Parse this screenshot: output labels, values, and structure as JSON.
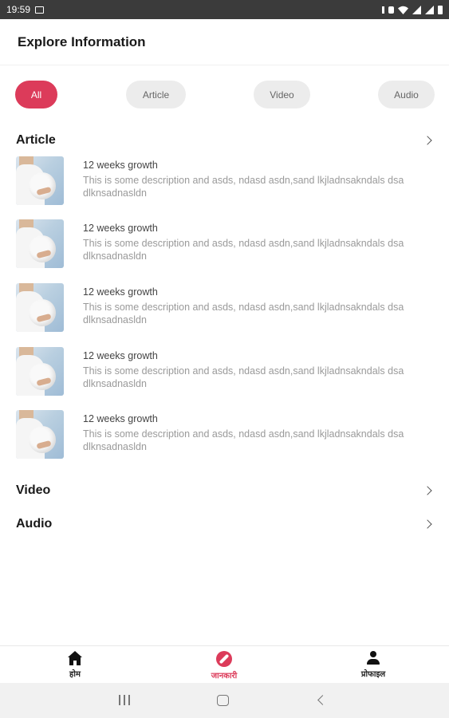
{
  "status_bar": {
    "time": "19:59"
  },
  "app_bar": {
    "title": "Explore Information"
  },
  "filter_chips": [
    {
      "label": "All",
      "selected": true
    },
    {
      "label": "Article",
      "selected": false
    },
    {
      "label": "Video",
      "selected": false
    },
    {
      "label": "Audio",
      "selected": false
    }
  ],
  "sections": {
    "article": {
      "label": "Article",
      "items": [
        {
          "title": "12 weeks growth",
          "description": "This is some description and asds, ndasd asdn,sand lkjladnsakndals dsa dlknsadnasldn"
        },
        {
          "title": "12 weeks growth",
          "description": "This is some description and asds, ndasd asdn,sand lkjladnsakndals dsa dlknsadnasldn"
        },
        {
          "title": "12 weeks growth",
          "description": "This is some description and asds, ndasd asdn,sand lkjladnsakndals dsa dlknsadnasldn"
        },
        {
          "title": "12 weeks growth",
          "description": "This is some description and asds, ndasd asdn,sand lkjladnsakndals dsa dlknsadnasldn"
        },
        {
          "title": "12 weeks growth",
          "description": "This is some description and asds, ndasd asdn,sand lkjladnsakndals dsa dlknsadnasldn"
        }
      ]
    },
    "video": {
      "label": "Video"
    },
    "audio": {
      "label": "Audio"
    }
  },
  "bottom_nav": {
    "items": [
      {
        "label": "होम",
        "icon": "home-icon",
        "active": false
      },
      {
        "label": "जानकारी",
        "icon": "compass-icon",
        "active": true
      },
      {
        "label": "प्रोफाइल",
        "icon": "person-icon",
        "active": false
      }
    ]
  },
  "colors": {
    "accent": "#dc3b5a",
    "chip_inactive": "#ececec",
    "status_bar": "#3b3b3b"
  }
}
